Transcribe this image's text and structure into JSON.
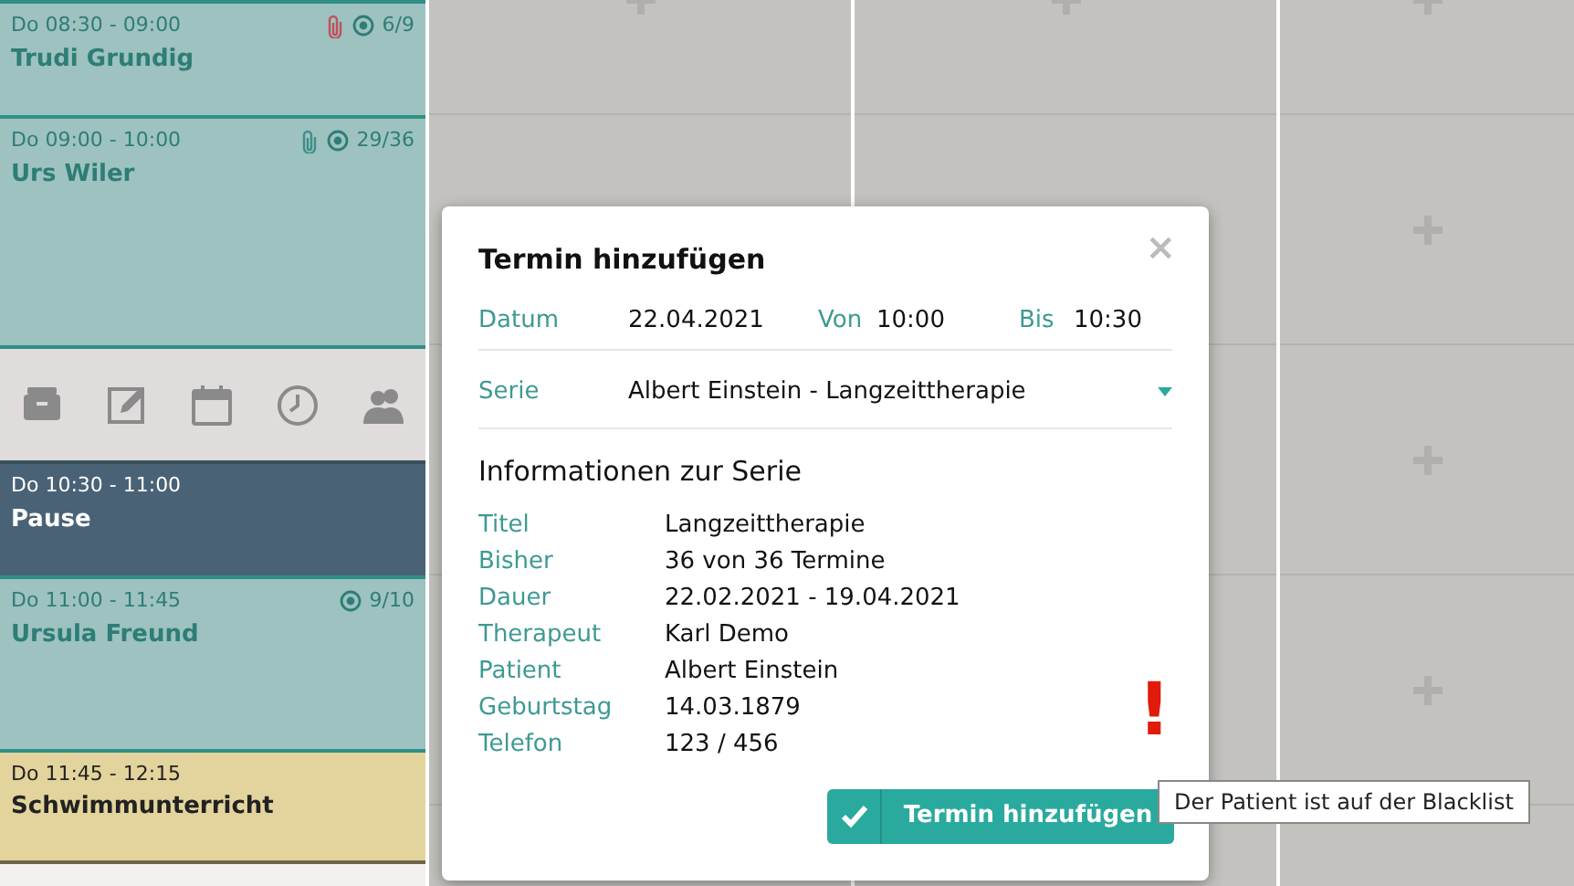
{
  "calendar": {
    "events": [
      {
        "kind": "appointment",
        "time": "Do 08:30 - 09:00",
        "name": "Trudi Grundig",
        "attachment": {
          "color": "#c0505a"
        },
        "count": "6/9"
      },
      {
        "kind": "appointment",
        "time": "Do 09:00 - 10:00",
        "name": "Urs Wiler",
        "attachment": {
          "color": "#3d8f89"
        },
        "count": "29/36"
      },
      {
        "kind": "toolbar"
      },
      {
        "kind": "break",
        "time": "Do 10:30 - 11:00",
        "name": "Pause"
      },
      {
        "kind": "appointment",
        "time": "Do 11:00 - 11:45",
        "name": "Ursula Freund",
        "count": "9/10"
      },
      {
        "kind": "private",
        "time": "Do 11:45 - 12:15",
        "name": "Schwimmunterricht"
      }
    ]
  },
  "dialog": {
    "title": "Termin hinzufügen",
    "close": "×",
    "datum": {
      "label": "Datum",
      "value": "22.04.2021"
    },
    "von": {
      "label": "Von",
      "value": "10:00"
    },
    "bis": {
      "label": "Bis",
      "value": "10:30"
    },
    "serie": {
      "label": "Serie",
      "value": "Albert Einstein - Langzeittherapie"
    },
    "section_title": "Informationen zur Serie",
    "info": [
      {
        "label": "Titel",
        "value": "Langzeittherapie"
      },
      {
        "label": "Bisher",
        "value": "36 von 36 Termine"
      },
      {
        "label": "Dauer",
        "value": "22.02.2021 - 19.04.2021"
      },
      {
        "label": "Therapeut",
        "value": "Karl Demo"
      },
      {
        "label": "Patient",
        "value": "Albert Einstein"
      },
      {
        "label": "Geburtstag",
        "value": "14.03.1879"
      },
      {
        "label": "Telefon",
        "value": "123 / 456"
      }
    ],
    "warning": "!",
    "submit": "Termin hinzufügen"
  },
  "tooltip": "Der Patient ist auf der Blacklist"
}
